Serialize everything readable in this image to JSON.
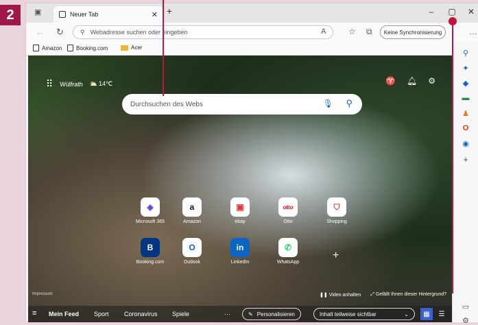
{
  "step_badge": "2",
  "titlebar": {
    "tab_title": "Neuer Tab",
    "new_tab": "+",
    "minimize": "–",
    "maximize": "▢",
    "close": "✕"
  },
  "addressbar": {
    "placeholder": "Webadresse suchen oder eingeben",
    "sync_button": "Keine Synchronisierung",
    "more": "…"
  },
  "favorites": [
    {
      "label": "Amazon",
      "icon": "page-icon"
    },
    {
      "label": "Booking.com",
      "icon": "page-icon"
    },
    {
      "label": "Acer",
      "icon": "folder-icon"
    }
  ],
  "newtab": {
    "location": "Wülfrath",
    "temperature": "14℃",
    "search_placeholder": "Durchsuchen des Webs",
    "tiles": [
      {
        "label": "Microsoft 365",
        "glyph": "◈",
        "color": "#5a3fd6"
      },
      {
        "label": "Amazon",
        "glyph": "a",
        "color": "#111111"
      },
      {
        "label": "ebay",
        "glyph": "▣",
        "color": "#e53238"
      },
      {
        "label": "Otto",
        "glyph": "otto",
        "color": "#e3000f"
      },
      {
        "label": "Shopping",
        "glyph": "⛉",
        "color": "#e8434a"
      },
      {
        "label": "Booking.com",
        "glyph": "B",
        "color": "#003580"
      },
      {
        "label": "Outlook",
        "glyph": "O",
        "color": "#0a64c8"
      },
      {
        "label": "LinkedIn",
        "glyph": "in",
        "color": "#0a66c2"
      },
      {
        "label": "WhatsApp",
        "glyph": "✆",
        "color": "#25d366"
      }
    ],
    "add_tile": "+",
    "impressum": "Impressum",
    "video_toggle": "Video anhalten",
    "background_feedback": "Gefällt Ihnen dieser Hintergrund?"
  },
  "feedbar": {
    "tabs": [
      "Mein Feed",
      "Sport",
      "Coronavirus",
      "Spiele"
    ],
    "more": "···",
    "personalize": "Personalisieren",
    "visibility": "Inhalt teilweise sichtbar"
  },
  "colors": {
    "annotation": "#c0143c",
    "badge": "#a0174a",
    "edge_blue": "#1a5fc9"
  }
}
